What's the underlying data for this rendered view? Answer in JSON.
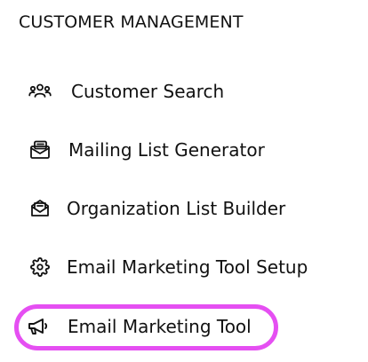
{
  "section": {
    "title": "CUSTOMER MANAGEMENT"
  },
  "menu": {
    "items": [
      {
        "label": "Customer Search",
        "icon": "users-group-icon"
      },
      {
        "label": "Mailing List Generator",
        "icon": "mail-stack-icon"
      },
      {
        "label": "Organization List Builder",
        "icon": "envelope-open-icon"
      },
      {
        "label": "Email Marketing Tool Setup",
        "icon": "gear-icon"
      },
      {
        "label": "Email Marketing Tool",
        "icon": "megaphone-icon",
        "active": true
      }
    ]
  },
  "colors": {
    "text": "#111111",
    "highlight_border": "#e54ff2",
    "background": "#ffffff"
  }
}
